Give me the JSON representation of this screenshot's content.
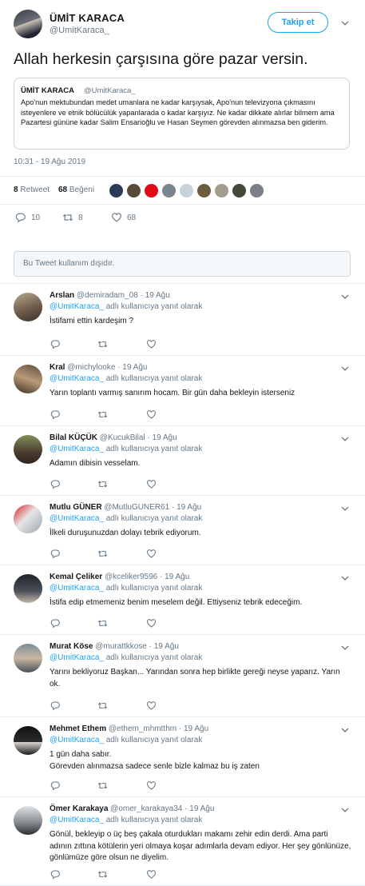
{
  "tweet": {
    "author_name": "ÜMİT KARACA",
    "author_handle": "@UmitKaraca_",
    "follow_label": "Takip et",
    "text": "Allah herkesin çarşısına göre pazar versin.",
    "quote": {
      "author_name": "ÜMİT KARACA",
      "author_handle": "@UmitKaraca_",
      "text": "Apo'nun mektubundan medet umanlara ne kadar karşıysak, Apo'nun televizyona çıkmasını isteyenlere ve etnik bölücülük yapanlarada o kadar karşıyız. Ne kadar dikkate alırlar bilmem ama Pazartesi gününe kadar Salim Ensarioğlu ve Hasan Seymen görevden alınmazsa ben giderim."
    },
    "timestamp": "10:31 - 19 Ağu 2019",
    "retweet_count": "8",
    "retweet_label": "Retweet",
    "like_count": "68",
    "like_label": "Beğeni",
    "actions": {
      "reply_count": "10",
      "retweet_count": "8",
      "like_count": "68"
    },
    "disabled_notice": "Bu Tweet kullanım dışıdır."
  },
  "reply_to_prefix": "@UmitKaraca_",
  "reply_to_suffix": " adlı kullanıcıya yanıt olarak",
  "replies": [
    {
      "name": "Arslan",
      "handle": "@demiradam_08",
      "date": "19 Ağu",
      "text": "İstifami ettin kardeşim ?"
    },
    {
      "name": "Kral",
      "handle": "@michylooke",
      "date": "19 Ağu",
      "text": "Yarın toplantı varmış sanırım hocam. Bir gün daha bekleyin isterseniz"
    },
    {
      "name": "Bilal KÜÇÜK",
      "handle": "@KucukBilal",
      "date": "19 Ağu",
      "text": "Adamın dibisin vesselam."
    },
    {
      "name": "Mutlu GÜNER",
      "handle": "@MutluGUNER61",
      "date": "19 Ağu",
      "text": "İlkeli duruşunuzdan dolayı tebrik ediyorum."
    },
    {
      "name": "Kemal Çeliker",
      "handle": "@kceliker9596",
      "date": "19 Ağu",
      "text": "İstifa edip etmemeniz benim meselem değil. Ettiyseniz tebrik edeceğim."
    },
    {
      "name": "Murat Köse",
      "handle": "@murattkkose",
      "date": "19 Ağu",
      "text": "Yarını bekliyoruz Başkan... Yarından sonra hep birlikte gereği neyse yaparız. Yarın ok."
    },
    {
      "name": "Mehmet Ethem",
      "handle": "@ethem_mhmtthm",
      "date": "19 Ağu",
      "text": "1 gün daha sabır.\nGörevden alınmazsa sadece senle bizle kalmaz bu iş zaten"
    },
    {
      "name": "Ömer Karakaya",
      "handle": "@omer_karakaya34",
      "date": "19 Ağu",
      "text": "Gönül, bekleyip o üç beş çakala oturdukları makamı zehir edin derdi. Ama parti adının zıttına kötülerin yeri olmaya koşar adımlarla devam ediyor. Her şey gönlünüze, gönlümüze göre olsun ne diyelim."
    }
  ],
  "colors": {
    "accent": "#1da1f2",
    "secondary_text": "#657786",
    "border": "#e6ecf0"
  },
  "icons": {
    "reply": "reply-icon",
    "retweet": "retweet-icon",
    "like": "heart-icon",
    "more": "chevron-down-icon"
  }
}
